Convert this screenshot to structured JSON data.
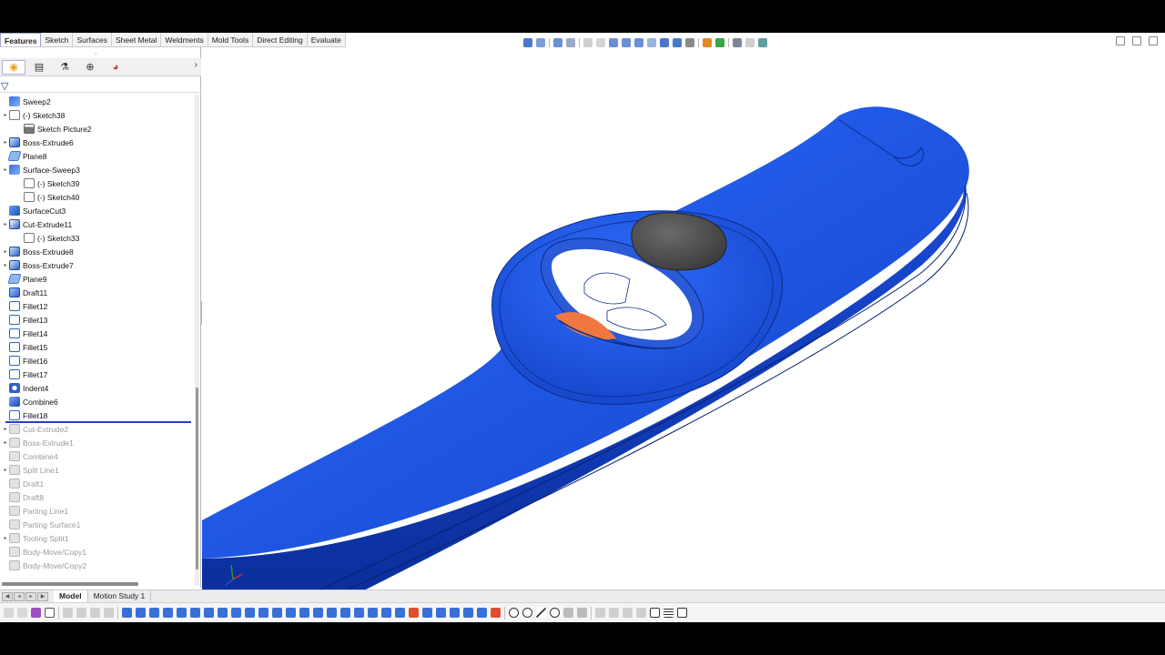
{
  "command_tabs": [
    {
      "label": "Features",
      "active": true
    },
    {
      "label": "Sketch"
    },
    {
      "label": "Surfaces"
    },
    {
      "label": "Sheet Metal"
    },
    {
      "label": "Weldments"
    },
    {
      "label": "Mold Tools"
    },
    {
      "label": "Direct Editing"
    },
    {
      "label": "Evaluate"
    }
  ],
  "feature_tree": [
    {
      "label": "Sweep2",
      "icon": "sweep-icon",
      "indent": 0,
      "expander": false
    },
    {
      "label": "(-) Sketch38",
      "icon": "sketch-icon",
      "indent": 0,
      "expander": true
    },
    {
      "label": "Sketch Picture2",
      "icon": "sketch-picture-icon",
      "indent": 1,
      "expander": false
    },
    {
      "label": "Boss-Extrude6",
      "icon": "boss-extrude-icon",
      "indent": 0,
      "expander": true
    },
    {
      "label": "Plane8",
      "icon": "plane-icon",
      "indent": 0,
      "expander": false
    },
    {
      "label": "Surface-Sweep3",
      "icon": "surface-sweep-icon",
      "indent": 0,
      "expander": true
    },
    {
      "label": "(-) Sketch39",
      "icon": "sketch-icon",
      "indent": 1,
      "expander": false
    },
    {
      "label": "(-) Sketch40",
      "icon": "sketch-icon",
      "indent": 1,
      "expander": false
    },
    {
      "label": "SurfaceCut3",
      "icon": "surface-cut-icon",
      "indent": 0,
      "expander": false
    },
    {
      "label": "Cut-Extrude11",
      "icon": "cut-extrude-icon",
      "indent": 0,
      "expander": true
    },
    {
      "label": "(-) Sketch33",
      "icon": "sketch-icon",
      "indent": 1,
      "expander": false
    },
    {
      "label": "Boss-Extrude8",
      "icon": "boss-extrude-icon",
      "indent": 0,
      "expander": true
    },
    {
      "label": "Boss-Extrude7",
      "icon": "boss-extrude-icon",
      "indent": 0,
      "expander": true
    },
    {
      "label": "Plane9",
      "icon": "plane-icon",
      "indent": 0,
      "expander": false
    },
    {
      "label": "Draft11",
      "icon": "draft-icon",
      "indent": 0,
      "expander": false
    },
    {
      "label": "Fillet12",
      "icon": "fillet-icon",
      "indent": 0,
      "expander": false
    },
    {
      "label": "Fillet13",
      "icon": "fillet-icon",
      "indent": 0,
      "expander": false
    },
    {
      "label": "Fillet14",
      "icon": "fillet-icon",
      "indent": 0,
      "expander": false
    },
    {
      "label": "Fillet15",
      "icon": "fillet-icon",
      "indent": 0,
      "expander": false
    },
    {
      "label": "Fillet16",
      "icon": "fillet-icon",
      "indent": 0,
      "expander": false
    },
    {
      "label": "Fillet17",
      "icon": "fillet-icon",
      "indent": 0,
      "expander": false
    },
    {
      "label": "Indent4",
      "icon": "indent-icon",
      "indent": 0,
      "expander": false
    },
    {
      "label": "Combine6",
      "icon": "combine-icon",
      "indent": 0,
      "expander": false
    },
    {
      "label": "Fillet18",
      "icon": "fillet-icon",
      "indent": 0,
      "expander": false
    },
    {
      "label": "Cut-Extrude2",
      "icon": "cut-extrude-icon",
      "indent": 0,
      "expander": true,
      "suppressed": true
    },
    {
      "label": "Boss-Extrude1",
      "icon": "boss-extrude-icon",
      "indent": 0,
      "expander": true,
      "suppressed": true
    },
    {
      "label": "Combine4",
      "icon": "combine-icon",
      "indent": 0,
      "expander": false,
      "suppressed": true
    },
    {
      "label": "Split Line1",
      "icon": "split-line-icon",
      "indent": 0,
      "expander": true,
      "suppressed": true
    },
    {
      "label": "Draft1",
      "icon": "draft-icon",
      "indent": 0,
      "expander": false,
      "suppressed": true
    },
    {
      "label": "Draft8",
      "icon": "draft-icon",
      "indent": 0,
      "expander": false,
      "suppressed": true
    },
    {
      "label": "Parting Line1",
      "icon": "parting-line-icon",
      "indent": 0,
      "expander": false,
      "suppressed": true
    },
    {
      "label": "Parting Surface1",
      "icon": "parting-surface-icon",
      "indent": 0,
      "expander": false,
      "suppressed": true
    },
    {
      "label": "Tooling Split1",
      "icon": "tooling-split-icon",
      "indent": 0,
      "expander": true,
      "suppressed": true
    },
    {
      "label": "Body-Move/Copy1",
      "icon": "body-move-icon",
      "indent": 0,
      "expander": false,
      "suppressed": true
    },
    {
      "label": "Body-Move/Copy2",
      "icon": "body-move-icon",
      "indent": 0,
      "expander": false,
      "suppressed": true
    }
  ],
  "model_tabs": [
    {
      "label": "Model",
      "active": true
    },
    {
      "label": "Motion Study 1"
    }
  ],
  "colors": {
    "part_blue": "#1e55e0",
    "part_blue_dark": "#0b2f9c",
    "button_grey": "#5a5a5a",
    "accent_orange": "#f07840",
    "rollback_bar": "#2a3fbf"
  }
}
